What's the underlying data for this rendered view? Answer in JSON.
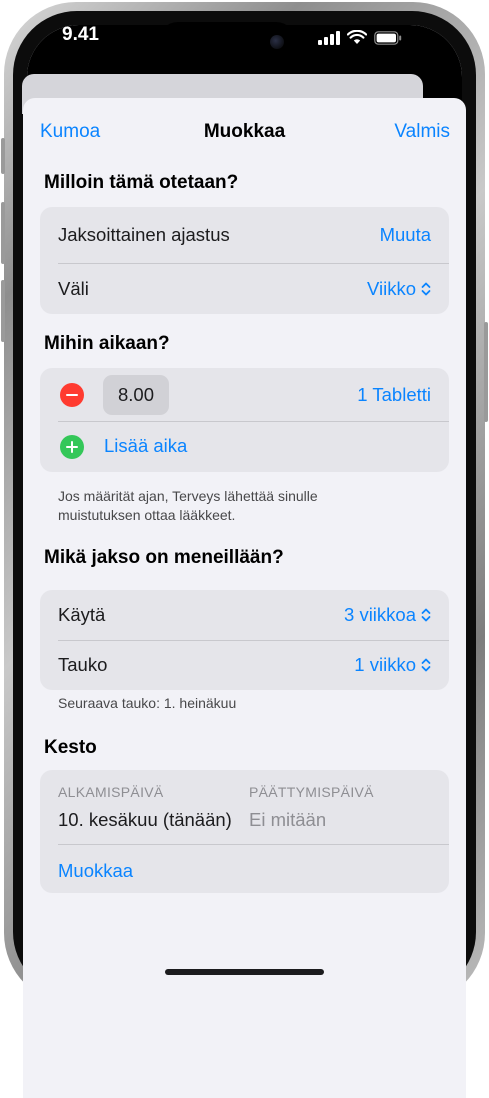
{
  "status_bar": {
    "time": "9.41"
  },
  "nav": {
    "cancel": "Kumoa",
    "title": "Muokkaa",
    "done": "Valmis"
  },
  "when": {
    "heading": "Milloin tämä otetaan?",
    "schedule_label": "Jaksoittainen ajastus",
    "schedule_action": "Muuta",
    "interval_label": "Väli",
    "interval_value": "Viikko"
  },
  "time": {
    "heading": "Mihin aikaan?",
    "entries": [
      {
        "time": "8.00",
        "dose": "1 Tabletti"
      }
    ],
    "add_label": "Lisää aika",
    "footnote": "Jos määrität ajan, Terveys lähettää sinulle muistutuksen ottaa lääkkeet."
  },
  "cycle": {
    "heading": "Mikä jakso on meneillään?",
    "use_label": "Käytä",
    "use_value": "3 viikkoa",
    "pause_label": "Tauko",
    "pause_value": "1 viikko",
    "footnote": "Seuraava tauko: 1. heinäkuu"
  },
  "duration": {
    "heading": "Kesto",
    "start_label": "ALKAMISPÄIVÄ",
    "start_value": "10. kesäkuu (tänään)",
    "end_label": "PÄÄTTYMISPÄIVÄ",
    "end_value": "Ei mitään",
    "edit_label": "Muokkaa"
  },
  "colors": {
    "accent": "#0a84ff",
    "remove": "#ff3b30",
    "add": "#34c759"
  }
}
